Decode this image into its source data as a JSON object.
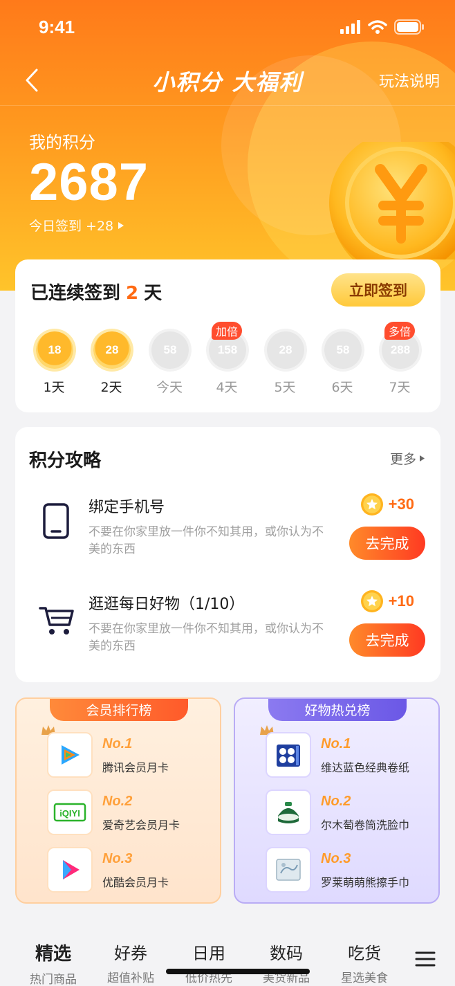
{
  "status_bar": {
    "time": "9:41"
  },
  "nav": {
    "title": "小积分 大福利",
    "rules": "玩法说明"
  },
  "points": {
    "label": "我的积分",
    "value": "2687",
    "today": "今日签到 +28"
  },
  "signin": {
    "prefix": "已连续签到",
    "days": "2",
    "suffix": "天",
    "button": "立即签到",
    "days_list": [
      {
        "points": "18",
        "label": "1天",
        "state": "done",
        "tag": ""
      },
      {
        "points": "28",
        "label": "2天",
        "state": "done",
        "tag": ""
      },
      {
        "points": "58",
        "label": "今天",
        "state": "todo",
        "tag": ""
      },
      {
        "points": "158",
        "label": "4天",
        "state": "todo",
        "tag": "加倍"
      },
      {
        "points": "28",
        "label": "5天",
        "state": "todo",
        "tag": ""
      },
      {
        "points": "58",
        "label": "6天",
        "state": "todo",
        "tag": ""
      },
      {
        "points": "288",
        "label": "7天",
        "state": "todo",
        "tag": "多倍"
      }
    ]
  },
  "guide": {
    "title": "积分攻略",
    "more": "更多",
    "tasks": [
      {
        "name": "绑定手机号",
        "desc": "不要在你家里放一件你不知其用，或你认为不美的东西",
        "reward": "+30",
        "button": "去完成",
        "icon": "phone-icon"
      },
      {
        "name": "逛逛每日好物（1/10）",
        "desc": "不要在你家里放一件你不知其用，或你认为不美的东西",
        "reward": "+10",
        "button": "去完成",
        "icon": "cart-icon"
      }
    ]
  },
  "member_rank": {
    "title": "会员排行榜",
    "items": [
      {
        "no": "No.1",
        "name": "腾讯会员月卡",
        "icon": "tencent-video-icon"
      },
      {
        "no": "No.2",
        "name": "爱奇艺会员月卡",
        "icon": "iqiyi-icon",
        "logo_text": "iQIYI"
      },
      {
        "no": "No.3",
        "name": "优酷会员月卡",
        "icon": "youku-icon"
      }
    ]
  },
  "goods_rank": {
    "title": "好物热兑榜",
    "items": [
      {
        "no": "No.1",
        "name": "维达蓝色经典卷纸",
        "icon": "tissue-roll-icon"
      },
      {
        "no": "No.2",
        "name": "尔木萄卷筒洗脸巾",
        "icon": "face-towel-icon"
      },
      {
        "no": "No.3",
        "name": "罗莱萌萌熊擦手巾",
        "icon": "hand-towel-icon"
      }
    ]
  },
  "bottom_nav": [
    {
      "main": "精选",
      "sub": "热门商品",
      "active": true
    },
    {
      "main": "好券",
      "sub": "超值补贴",
      "active": false
    },
    {
      "main": "日用",
      "sub": "低价热先",
      "active": false
    },
    {
      "main": "数码",
      "sub": "美货新品",
      "active": false
    },
    {
      "main": "吃货",
      "sub": "星选美食",
      "active": false
    }
  ],
  "colors": {
    "accent": "#ff6a13",
    "hero_top": "#ff7a1a",
    "hero_bottom": "#ffc42a",
    "button_red": "#ff3a22",
    "purple": "#6b58e6"
  }
}
